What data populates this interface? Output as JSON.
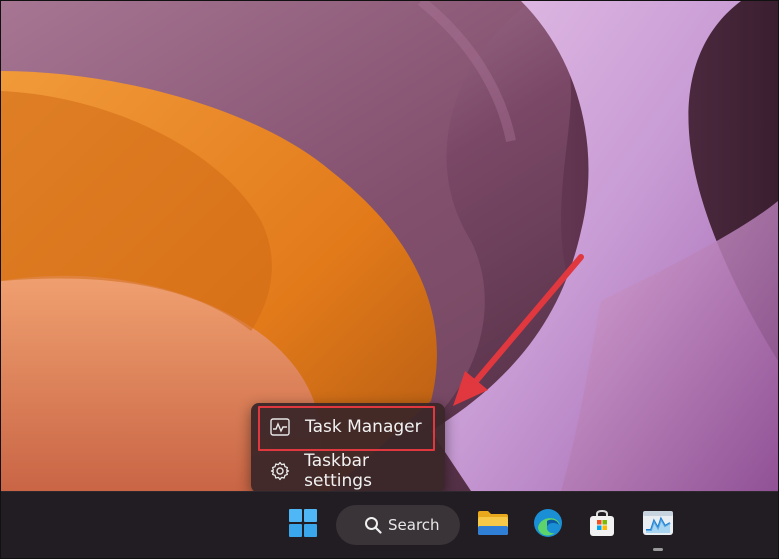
{
  "context_menu": {
    "items": [
      {
        "label": "Task Manager",
        "icon": "task-manager-icon"
      },
      {
        "label": "Taskbar settings",
        "icon": "gear-icon"
      }
    ]
  },
  "taskbar": {
    "start_icon": "windows-start-icon",
    "search_label": "Search",
    "apps": [
      {
        "icon": "file-explorer-icon"
      },
      {
        "icon": "edge-icon"
      },
      {
        "icon": "microsoft-store-icon"
      },
      {
        "icon": "task-manager-app-icon",
        "running": true
      }
    ]
  },
  "annotation": {
    "highlight_color": "#e0383e",
    "arrow_color": "#e0383e"
  }
}
